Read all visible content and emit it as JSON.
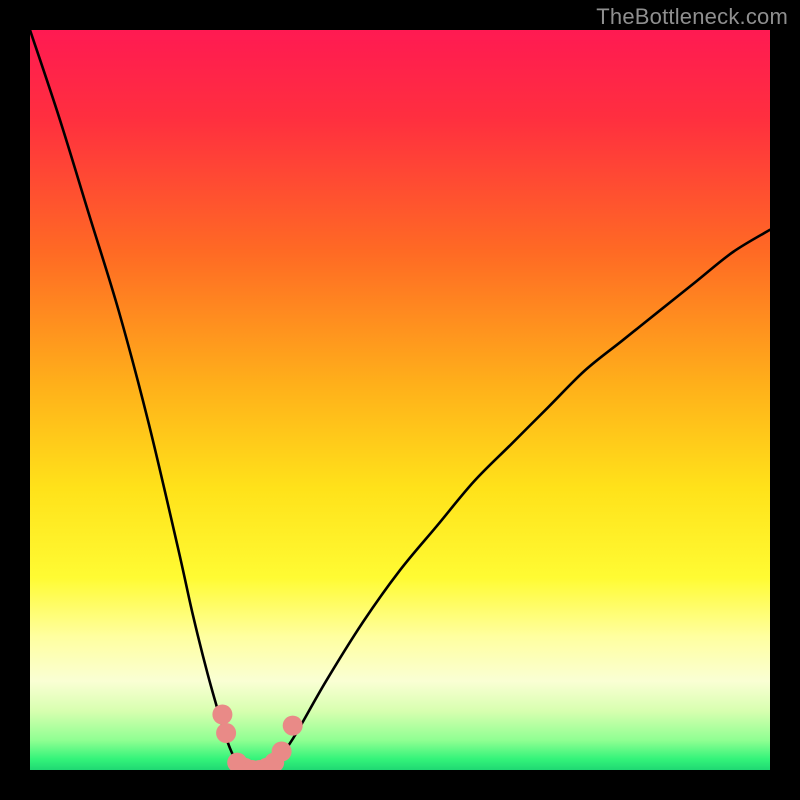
{
  "watermark": "TheBottleneck.com",
  "gradient_stops": [
    {
      "offset": 0.0,
      "color": "#ff1a52"
    },
    {
      "offset": 0.12,
      "color": "#ff2f3f"
    },
    {
      "offset": 0.3,
      "color": "#ff6a24"
    },
    {
      "offset": 0.48,
      "color": "#ffb01a"
    },
    {
      "offset": 0.62,
      "color": "#ffe21a"
    },
    {
      "offset": 0.74,
      "color": "#fffb33"
    },
    {
      "offset": 0.82,
      "color": "#ffffa0"
    },
    {
      "offset": 0.88,
      "color": "#faffd4"
    },
    {
      "offset": 0.92,
      "color": "#d8ffb0"
    },
    {
      "offset": 0.96,
      "color": "#8fff92"
    },
    {
      "offset": 0.985,
      "color": "#34f47a"
    },
    {
      "offset": 1.0,
      "color": "#1fd873"
    }
  ],
  "marker_color": "#e98a87",
  "curve_color": "#000000",
  "chart_data": {
    "type": "line",
    "title": "",
    "xlabel": "",
    "ylabel": "",
    "xlim": [
      0,
      100
    ],
    "ylim": [
      0,
      100
    ],
    "series": [
      {
        "name": "bottleneck-curve",
        "x": [
          0,
          4,
          8,
          12,
          16,
          20,
          22,
          24,
          26,
          27,
          28,
          29,
          30,
          31,
          32,
          33,
          34,
          36,
          40,
          45,
          50,
          55,
          60,
          65,
          70,
          75,
          80,
          85,
          90,
          95,
          100
        ],
        "y": [
          100,
          88,
          75,
          62,
          47,
          30,
          21,
          13,
          6,
          3,
          1,
          0,
          0,
          0,
          0,
          1,
          2,
          5,
          12,
          20,
          27,
          33,
          39,
          44,
          49,
          54,
          58,
          62,
          66,
          70,
          73
        ]
      }
    ],
    "markers": [
      {
        "x": 26.0,
        "y": 7.5
      },
      {
        "x": 26.5,
        "y": 5.0
      },
      {
        "x": 28.0,
        "y": 1.0
      },
      {
        "x": 29.0,
        "y": 0.3
      },
      {
        "x": 30.0,
        "y": 0.0
      },
      {
        "x": 31.0,
        "y": 0.0
      },
      {
        "x": 32.0,
        "y": 0.3
      },
      {
        "x": 33.0,
        "y": 1.0
      },
      {
        "x": 34.0,
        "y": 2.5
      },
      {
        "x": 35.5,
        "y": 6.0
      }
    ]
  }
}
